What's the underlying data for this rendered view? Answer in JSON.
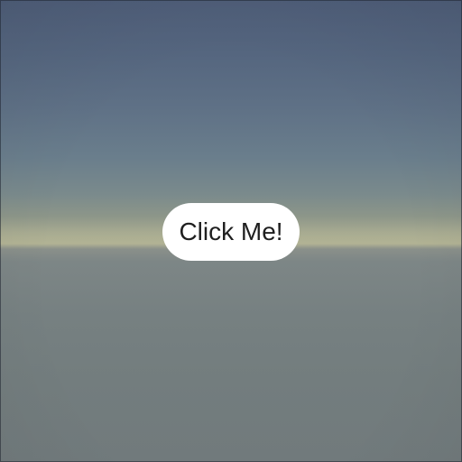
{
  "scene": {
    "button_label": "Click Me!",
    "button_color": "#ffffff",
    "button_text_color": "#1f1f1f",
    "sky_top_color": "#4e5d78",
    "horizon_color": "#b2b394",
    "ground_color": "#737d7e"
  }
}
